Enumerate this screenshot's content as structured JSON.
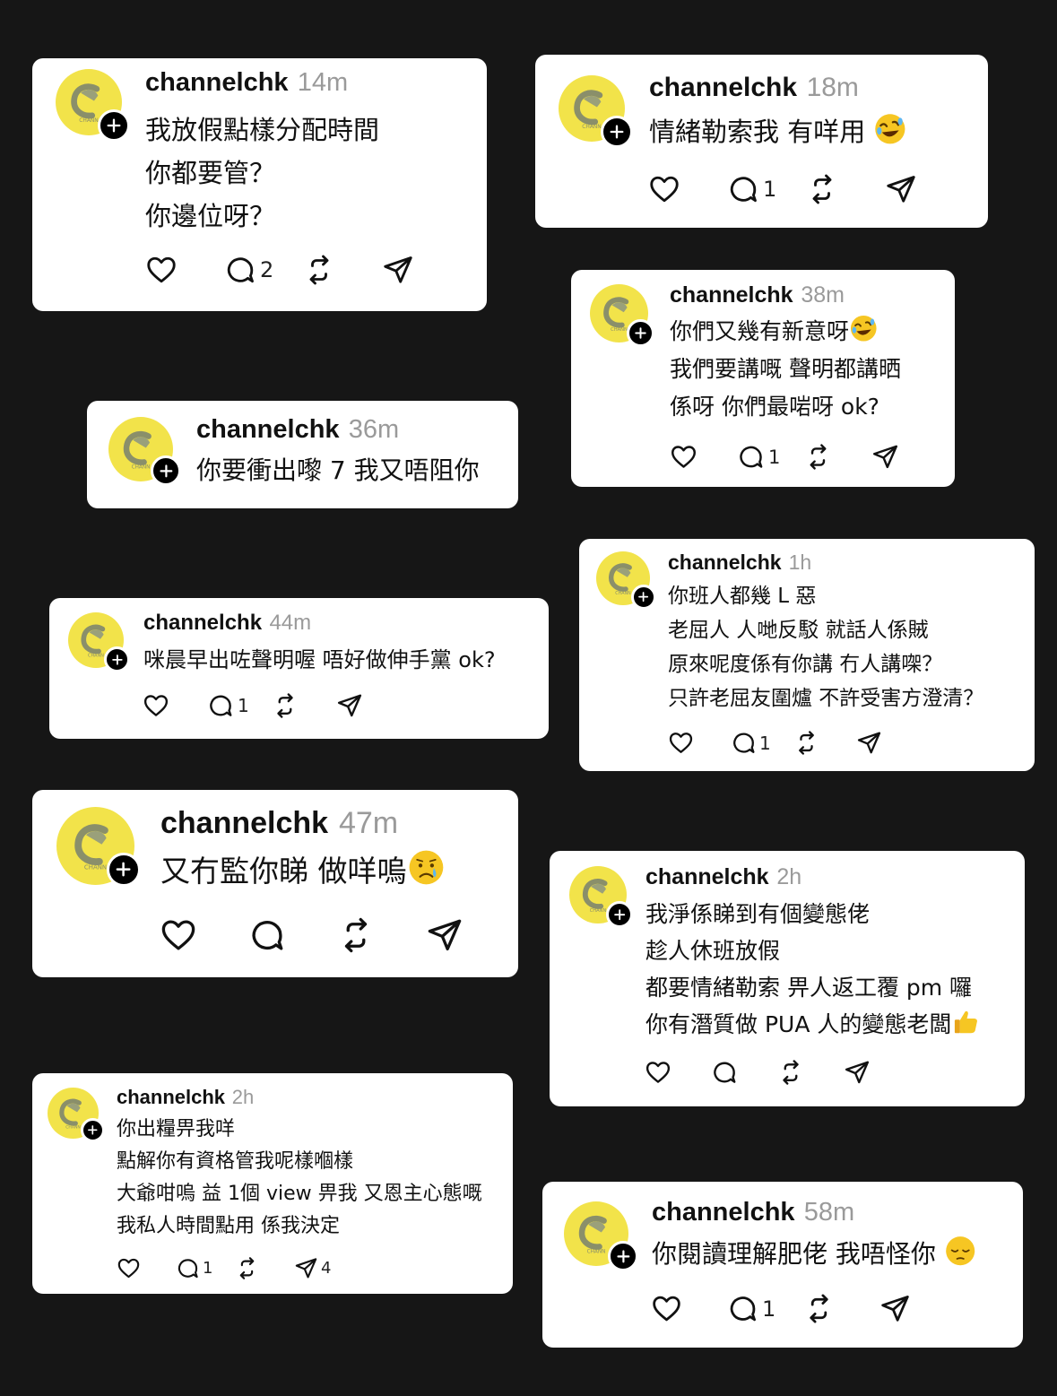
{
  "user": "channelchk",
  "avatar_label": "CHANN",
  "posts": [
    {
      "time": "14m",
      "lines": [
        "我放假點樣分配時間",
        "你都要管？",
        "你邊位呀？"
      ],
      "reply_count": "2",
      "repost_count": "",
      "share_count": ""
    },
    {
      "time": "18m",
      "lines": [
        "情緒勒索我 有咩用"
      ],
      "emoji": "rofl",
      "reply_count": "1",
      "repost_count": "",
      "share_count": ""
    },
    {
      "time": "38m",
      "lines": [
        "你們又幾有新意呀",
        "我們要講嘅 聲明都講晒",
        "係呀 你們最啱呀 ok?"
      ],
      "emoji": "rofl",
      "reply_count": "1",
      "repost_count": "",
      "share_count": ""
    },
    {
      "time": "36m",
      "lines": [
        "你要衝出嚟 7 我又唔阻你"
      ],
      "reply_count": "",
      "repost_count": "",
      "share_count": ""
    },
    {
      "time": "1h",
      "lines": [
        "你班人都幾 L 惡",
        "老屈人 人哋反駁 就話人係賊",
        "原來呢度係有你講 冇人講㗎？",
        "只許老屈友圍爐 不許受害方澄清？"
      ],
      "reply_count": "1",
      "repost_count": "",
      "share_count": ""
    },
    {
      "time": "44m",
      "lines": [
        "咪晨早出咗聲明喔 唔好做伸手黨 ok?"
      ],
      "reply_count": "1",
      "repost_count": "",
      "share_count": ""
    },
    {
      "time": "47m",
      "lines": [
        "又冇監你睇 做咩嗚"
      ],
      "emoji": "cry",
      "reply_count": "",
      "repost_count": "",
      "share_count": ""
    },
    {
      "time": "2h",
      "lines": [
        "我淨係睇到有個變態佬",
        "趁人休班放假",
        "都要情緒勒索 畀人返工覆 pm 囉",
        "你有潛質做 PUA 人的變態老闆"
      ],
      "emoji": "thumbs",
      "reply_count": "",
      "repost_count": "",
      "share_count": ""
    },
    {
      "time": "2h",
      "lines": [
        "你出糧畀我咩",
        "點解你有資格管我呢樣嗰樣",
        "大爺咁嗚 益 1個 view 畀我 又恩主心態嘅",
        "我私人時間點用 係我決定"
      ],
      "reply_count": "1",
      "repost_count": "",
      "share_count": "4"
    },
    {
      "time": "58m",
      "lines": [
        "你閱讀理解肥佬 我唔怪你"
      ],
      "emoji": "pensive",
      "reply_count": "1",
      "repost_count": "",
      "share_count": ""
    }
  ]
}
